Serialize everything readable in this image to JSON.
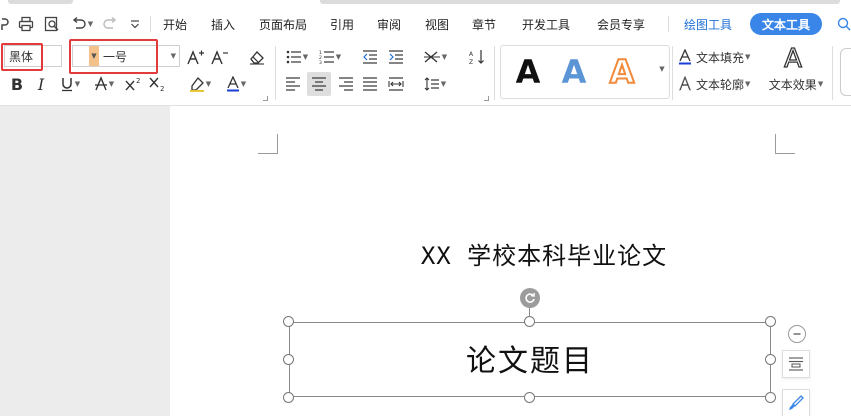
{
  "tabs": {
    "start": "开始",
    "insert": "插入",
    "page_layout": "页面布局",
    "references": "引用",
    "review": "审阅",
    "view": "视图",
    "section": "章节",
    "developer": "开发工具",
    "member": "会员专享",
    "drawing_tools": "绘图工具",
    "text_tools": "文本工具"
  },
  "ribbon": {
    "font_name": "黑体",
    "font_size": "一号",
    "text_fill": "文本填充",
    "text_outline": "文本轮廓",
    "text_effect": "文本效果",
    "art_styles": [
      "A",
      "A",
      "A"
    ],
    "effect_glyph": "A"
  },
  "document": {
    "school_line": "XX 学校本科毕业论文",
    "title": "论文题目"
  },
  "colors": {
    "accent": "#3a86e8",
    "highlight_red": "#e23b3b",
    "font_color_bar": "#1a3fd6",
    "art_blue": "#5b95d6",
    "art_orange": "#f28a3c"
  },
  "icons": [
    "print-icon",
    "print-preview-icon",
    "undo-icon",
    "redo-icon",
    "bold-icon",
    "italic-icon",
    "underline-icon",
    "strikethrough-icon",
    "superscript-icon",
    "subscript-icon",
    "highlight-icon",
    "font-color-icon",
    "clear-format-icon",
    "grow-font-icon",
    "shrink-font-icon",
    "bullet-list-icon",
    "numbered-list-icon",
    "align-left-icon",
    "align-center-icon",
    "search-icon"
  ]
}
